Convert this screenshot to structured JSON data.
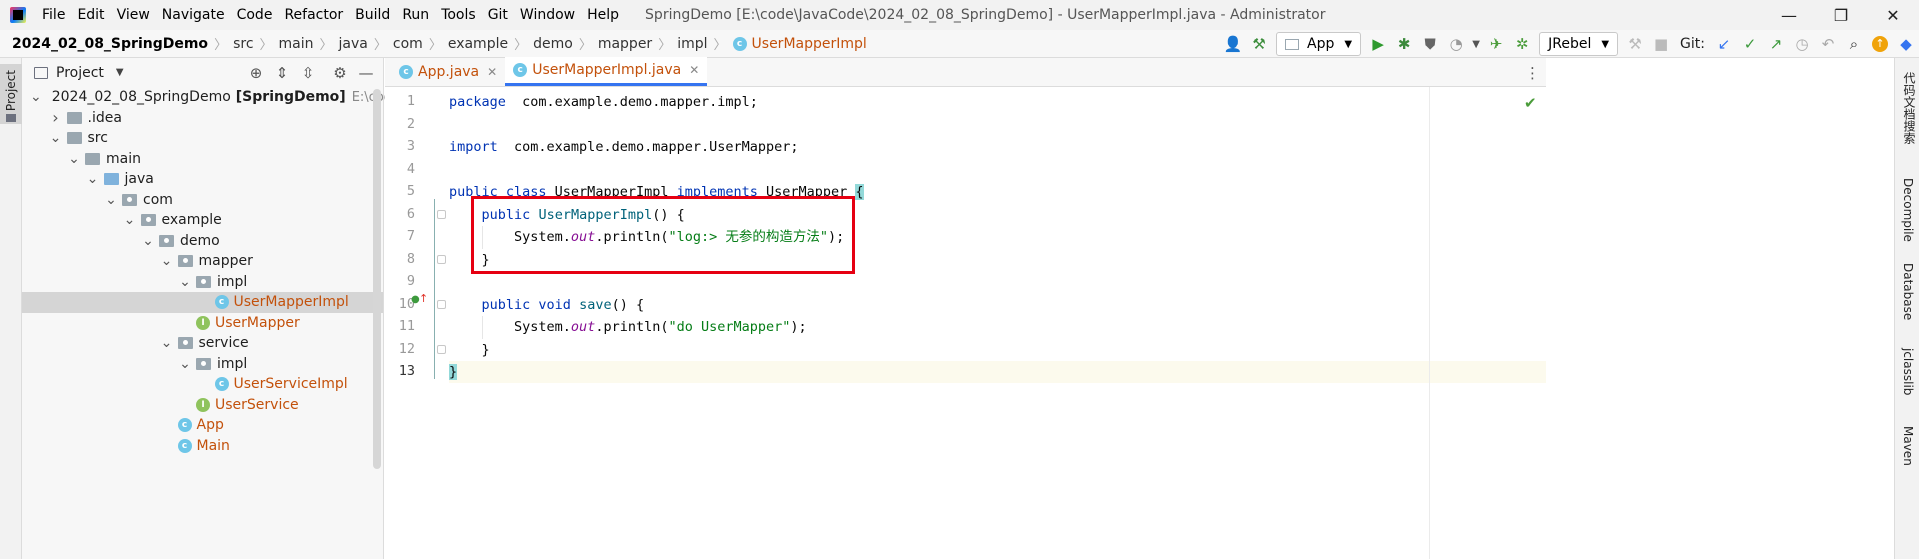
{
  "window": {
    "title": "SpringDemo [E:\\code\\JavaCode\\2024_02_08_SpringDemo] - UserMapperImpl.java - Administrator",
    "menu": [
      "File",
      "Edit",
      "View",
      "Navigate",
      "Code",
      "Refactor",
      "Build",
      "Run",
      "Tools",
      "Git",
      "Window",
      "Help"
    ],
    "controls": {
      "minimize": "—",
      "maximize": "❐",
      "close": "✕"
    }
  },
  "breadcrumb": [
    "2024_02_08_SpringDemo",
    "src",
    "main",
    "java",
    "com",
    "example",
    "demo",
    "mapper",
    "impl",
    "UserMapperImpl"
  ],
  "toolbar": {
    "run_config": "App",
    "plugin_combo": "JRebel",
    "git_label": "Git:"
  },
  "left_strip": {
    "project_tab": "Project"
  },
  "project_panel": {
    "title": "Project",
    "tree": [
      {
        "label": "2024_02_08_SpringDemo",
        "suffix": "[SpringDemo]",
        "path": "E:\\code\\Java",
        "depth": 0,
        "expanded": true,
        "kind": "module"
      },
      {
        "label": ".idea",
        "depth": 1,
        "expanded": false,
        "kind": "folder"
      },
      {
        "label": "src",
        "depth": 1,
        "expanded": true,
        "kind": "folder"
      },
      {
        "label": "main",
        "depth": 2,
        "expanded": true,
        "kind": "folder"
      },
      {
        "label": "java",
        "depth": 3,
        "expanded": true,
        "kind": "source"
      },
      {
        "label": "com",
        "depth": 4,
        "expanded": true,
        "kind": "package"
      },
      {
        "label": "example",
        "depth": 5,
        "expanded": true,
        "kind": "package"
      },
      {
        "label": "demo",
        "depth": 6,
        "expanded": true,
        "kind": "package"
      },
      {
        "label": "mapper",
        "depth": 7,
        "expanded": true,
        "kind": "package"
      },
      {
        "label": "impl",
        "depth": 8,
        "expanded": true,
        "kind": "package"
      },
      {
        "label": "UserMapperImpl",
        "depth": 9,
        "kind": "class",
        "selected": true
      },
      {
        "label": "UserMapper",
        "depth": 8,
        "kind": "interface"
      },
      {
        "label": "service",
        "depth": 7,
        "expanded": true,
        "kind": "package"
      },
      {
        "label": "impl",
        "depth": 8,
        "expanded": true,
        "kind": "package"
      },
      {
        "label": "UserServiceImpl",
        "depth": 9,
        "kind": "class"
      },
      {
        "label": "UserService",
        "depth": 8,
        "kind": "interface"
      },
      {
        "label": "App",
        "depth": 7,
        "kind": "class"
      },
      {
        "label": "Main",
        "depth": 7,
        "kind": "class"
      }
    ]
  },
  "editor": {
    "tabs": [
      {
        "label": "App.java",
        "active": false
      },
      {
        "label": "UserMapperImpl.java",
        "active": true
      }
    ],
    "current_line": 13,
    "lines": [
      {
        "n": "1",
        "tokens": [
          [
            "kw",
            "package"
          ],
          [
            "",
            "  com.example.demo.mapper.impl;"
          ]
        ]
      },
      {
        "n": "2",
        "tokens": []
      },
      {
        "n": "3",
        "tokens": [
          [
            "kw",
            "import"
          ],
          [
            "",
            "  com.example.demo.mapper.UserMapper;"
          ]
        ]
      },
      {
        "n": "4",
        "tokens": []
      },
      {
        "n": "5",
        "tokens": [
          [
            "kw",
            "public class"
          ],
          [
            "",
            " UserMapperImpl "
          ],
          [
            "kw",
            "implements"
          ],
          [
            "",
            " UserMapper "
          ],
          [
            "br",
            "{"
          ]
        ]
      },
      {
        "n": "6",
        "tokens": [
          [
            "",
            "    "
          ],
          [
            "kw",
            "public"
          ],
          [
            "",
            " "
          ],
          [
            "fn",
            "UserMapperImpl"
          ],
          [
            "",
            "() {"
          ]
        ]
      },
      {
        "n": "7",
        "tokens": [
          [
            "",
            "        System."
          ],
          [
            "fld",
            "out"
          ],
          [
            "",
            ".println("
          ],
          [
            "st",
            "\"log:> 无参的构造方法\""
          ],
          [
            "",
            ");"
          ]
        ]
      },
      {
        "n": "8",
        "tokens": [
          [
            "",
            "    }"
          ]
        ]
      },
      {
        "n": "9",
        "tokens": []
      },
      {
        "n": "10",
        "tokens": [
          [
            "",
            "    "
          ],
          [
            "kw",
            "public void"
          ],
          [
            "",
            " "
          ],
          [
            "fn",
            "save"
          ],
          [
            "",
            "() {"
          ]
        ]
      },
      {
        "n": "11",
        "tokens": [
          [
            "",
            "        System."
          ],
          [
            "fld",
            "out"
          ],
          [
            "",
            ".println("
          ],
          [
            "st",
            "\"do UserMapper\""
          ],
          [
            "",
            ");"
          ]
        ]
      },
      {
        "n": "12",
        "tokens": [
          [
            "",
            "    }"
          ]
        ]
      },
      {
        "n": "13",
        "tokens": [
          [
            "br",
            "}"
          ]
        ]
      }
    ]
  },
  "right_strip": {
    "tools": [
      "代码文档搜索",
      "Decompile",
      "Database",
      "jclasslib",
      "Maven"
    ]
  },
  "colors": {
    "keyword": "#0033b3",
    "string": "#067d17",
    "method": "#00627a",
    "field": "#871094",
    "class_name": "#c3510b",
    "annotation_box": "#e60012"
  }
}
